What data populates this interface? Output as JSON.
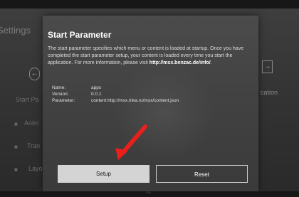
{
  "background": {
    "settings_title": "Settings",
    "left_items": [
      "Start Pa",
      "Anim",
      "Tran",
      "Layo"
    ],
    "right_item": "cation",
    "nav_left": "←",
    "nav_right": "→"
  },
  "dialog": {
    "title": "Start Parameter",
    "description": "The start parameter specifies which menu or content is loaded at startup. Once you have completed the start parameter setup, your content is loaded every time you start the application. For more information, please visit",
    "link": "http://msx.benzac.de/info/",
    "link_suffix": ".",
    "info": {
      "name_label": "Name:",
      "name_value": "apps",
      "version_label": "Version:",
      "version_value": "0.0.1",
      "parameter_label": "Parameter:",
      "parameter_value": "content:http://msx.lnka.ru/msx/content.json"
    },
    "buttons": {
      "setup": "Setup",
      "reset": "Reset"
    }
  },
  "annotation": {
    "arrow_color": "#e8201c"
  },
  "brand": "LG"
}
